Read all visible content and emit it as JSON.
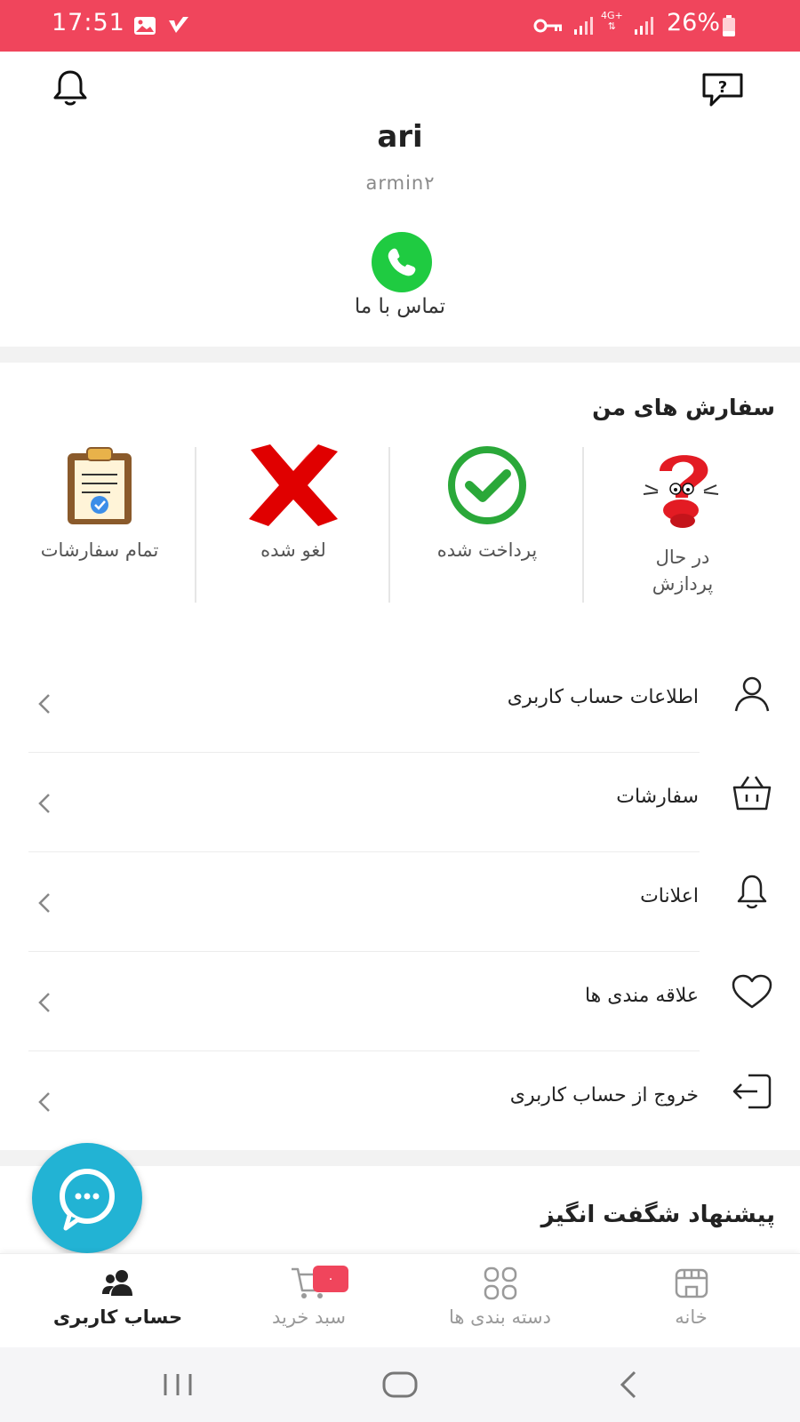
{
  "status_bar": {
    "time": "17:51",
    "network": "4G+",
    "battery": "26%"
  },
  "header": {
    "user_name": "ari",
    "user_handle": "armin۲",
    "call_label": "تماس با ما"
  },
  "orders": {
    "title": "سفارش های من",
    "items": [
      {
        "label_line1": "در حال",
        "label_line2": "پردازش",
        "icon": "question-mascot-icon"
      },
      {
        "label": "پرداخت شده",
        "icon": "check-circle-icon"
      },
      {
        "label": "لغو شده",
        "icon": "red-x-icon"
      },
      {
        "label": "تمام سفارشات",
        "icon": "clipboard-icon"
      }
    ]
  },
  "menu": {
    "items": [
      {
        "label": "اطلاعات حساب کاربری",
        "icon": "user-icon"
      },
      {
        "label": "سفارشات",
        "icon": "basket-icon"
      },
      {
        "label": "اعلانات",
        "icon": "bell-icon"
      },
      {
        "label": "علاقه مندی ها",
        "icon": "heart-icon"
      },
      {
        "label": "خروج از حساب کاربری",
        "icon": "logout-icon"
      }
    ]
  },
  "suggestion": {
    "title": "پیشنهاد شگفت انگیز"
  },
  "bottom_nav": {
    "items": [
      {
        "label": "خانه",
        "icon": "store-icon"
      },
      {
        "label": "دسته بندی ها",
        "icon": "categories-icon"
      },
      {
        "label": "سبد خرید",
        "icon": "cart-icon",
        "badge": "۰"
      },
      {
        "label": "حساب کاربری",
        "icon": "account-icon",
        "active": true
      }
    ]
  },
  "colors": {
    "brand": "#f0455c",
    "call_green": "#1fcb41",
    "fab": "#22b3d4",
    "check_green": "#2aa839",
    "cancel_red": "#e00000"
  }
}
